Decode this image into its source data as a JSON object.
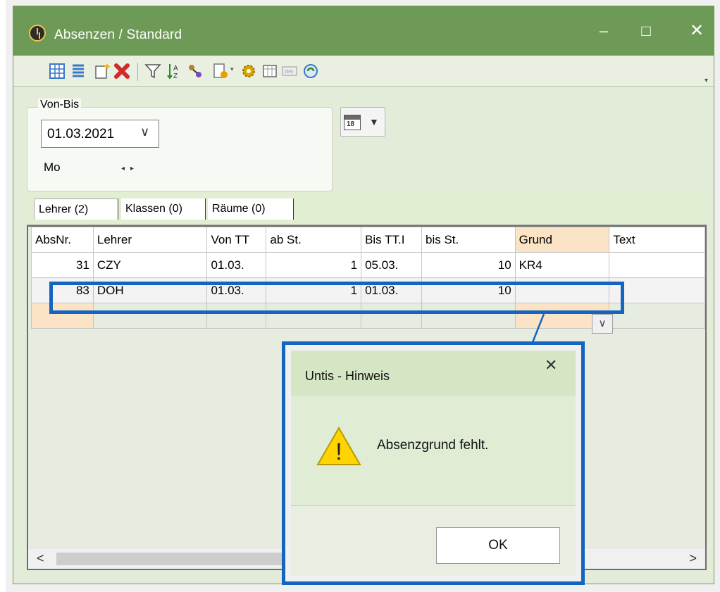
{
  "window": {
    "title": "Absenzen / Standard",
    "minimize_glyph": "–",
    "maximize_glyph": "□",
    "close_glyph": "✕"
  },
  "toolbar": {
    "icons": [
      "list-detail-icon",
      "list-view-icon",
      "new-record-icon",
      "delete-icon",
      "filter-icon",
      "sort-icon",
      "assign-icon",
      "report-icon",
      "settings-gear-icon",
      "calendar-grid-icon",
      "timetable-icon",
      "refresh-icon"
    ],
    "overflow_glyph": "▾"
  },
  "period": {
    "legend": "Von-Bis",
    "date": "01.03.2021",
    "date_chevron": "∨",
    "weekday": "Mo",
    "spin_glyphs": "◂▸",
    "calendar_day": "18",
    "calendar_arrow": "▼"
  },
  "tabs": [
    {
      "label": "Lehrer (2)"
    },
    {
      "label": "Klassen (0)"
    },
    {
      "label": "Räume (0)"
    }
  ],
  "grid": {
    "columns": [
      "AbsNr.",
      "Lehrer",
      "Von TT",
      "ab St.",
      "Bis TT.I",
      "bis St.",
      "Grund",
      "Text"
    ],
    "rows": [
      {
        "absnr": "31",
        "lehrer": "CZY",
        "von": "01.03.",
        "ab": "1",
        "bis": "05.03.",
        "bisst": "10",
        "grund": "KR4",
        "text": ""
      },
      {
        "absnr": "83",
        "lehrer": "DOH",
        "von": "01.03.",
        "ab": "1",
        "bis": "01.03.",
        "bisst": "10",
        "grund": "",
        "text": ""
      }
    ],
    "dropdown_glyph": "∨",
    "scroll_left": "<",
    "scroll_right": ">"
  },
  "dialog": {
    "title": "Untis - Hinweis",
    "close_glyph": "✕",
    "message": "Absenzgrund fehlt.",
    "warning_glyph": "!",
    "ok_label": "OK"
  },
  "colors": {
    "titlebar": "#6e9a57",
    "highlight": "#1565c0",
    "grund_header": "#fbe3c6",
    "warning": "#ffd400"
  }
}
